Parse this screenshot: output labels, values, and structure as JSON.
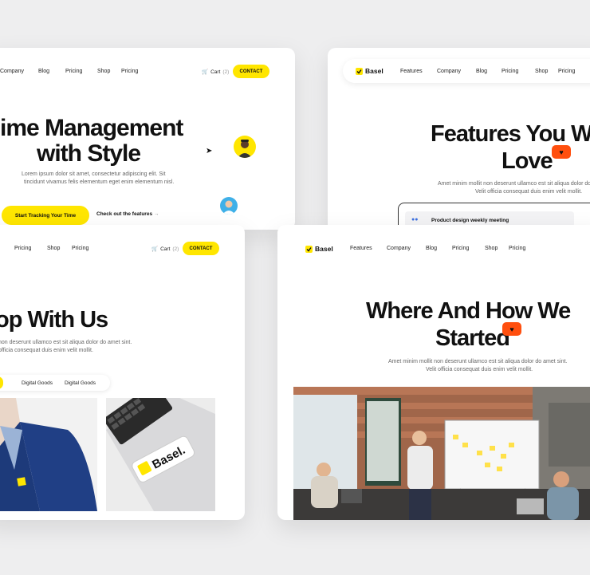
{
  "panel_a": {
    "nav": [
      "Company",
      "Blog",
      "Pricing",
      "Shop",
      "Pricing"
    ],
    "cart_label": "Cart",
    "cart_count": "(2)",
    "contact": "CONTACT",
    "headline_1": "ime Management",
    "headline_2": "with Style",
    "sub_1": "Lorem ipsum dolor sit amet, consectetur adipiscing elit. Sit",
    "sub_2": "tincidunt vivamus felis elementum eget enim elementum nisl.",
    "cta_primary": "Start Tracking Your Time",
    "cta_secondary": "Check out the features"
  },
  "panel_b": {
    "logo": "Basel",
    "nav": [
      "Features",
      "Company",
      "Blog",
      "Pricing",
      "Shop",
      "Pricing"
    ],
    "headline_1": "Features You W",
    "headline_2": "Love",
    "sub_1": "Amet minim mollit non deserunt ullamco est sit aliqua dolor do",
    "sub_2": "Velit officia consequat duis enim velit mollit.",
    "card_title": "Product design weekly meeting"
  },
  "panel_c": {
    "nav": [
      "Pricing",
      "Shop",
      "Pricing"
    ],
    "cart_label": "Cart",
    "cart_count": "(2)",
    "contact": "CONTACT",
    "headline": "op With Us",
    "sub_1": "non deserunt ullamco est sit aliqua dolor do amet sint.",
    "sub_2": "officia consequat duis enim velit mollit.",
    "tabs": [
      "Digital Goods",
      "Digital Goods"
    ],
    "sticker_text": "Basel."
  },
  "panel_d": {
    "logo": "Basel",
    "nav": [
      "Features",
      "Company",
      "Blog",
      "Pricing",
      "Shop",
      "Pricing"
    ],
    "headline_1": "Where And How We",
    "headline_2": "Started",
    "sub_1": "Amet minim mollit non deserunt ullamco est sit aliqua dolor do amet sint.",
    "sub_2": "Velit officia consequat duis enim velit mollit."
  },
  "colors": {
    "accent": "#ffe600",
    "heart": "#ff4f0e",
    "background": "#eeeeef"
  }
}
